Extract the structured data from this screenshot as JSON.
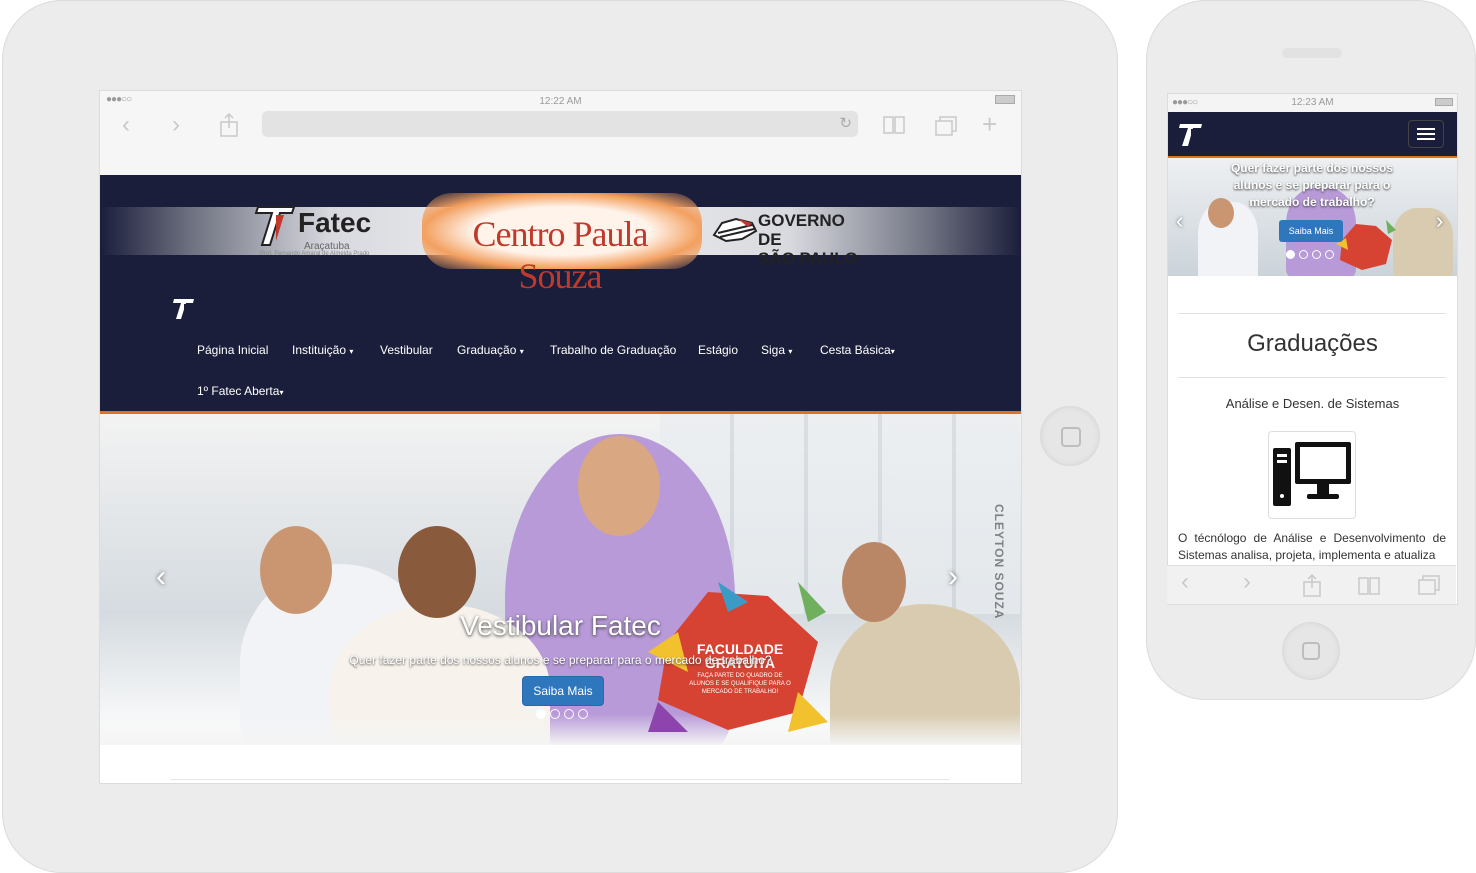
{
  "tablet": {
    "status": {
      "signal": "●●●○○",
      "time": "12:22 AM"
    },
    "header": {
      "fatec_word": "Fatec",
      "fatec_city": "Araçatuba",
      "fatec_patron": "Prof. Fernando Amaral de Almeida Prado",
      "center_logo": "Centro Paula Souza",
      "gov_logo_line1": "GOVERNO DE",
      "gov_logo_line2": "SÃO PAULO"
    },
    "nav": {
      "items": [
        {
          "label": "Página Inicial"
        },
        {
          "label": "Instituição"
        },
        {
          "label": "Vestibular"
        },
        {
          "label": "Graduação"
        },
        {
          "label": "Trabalho de Graduação"
        },
        {
          "label": "Estágio"
        },
        {
          "label": "Siga"
        },
        {
          "label": "Cesta Básica"
        },
        {
          "label": "1º Fatec Aberta"
        }
      ]
    },
    "hero": {
      "title": "Vestibular Fatec",
      "subtitle": "Quer fazer parte dos nossos alunos e se preparar para o mercado de trabalho?",
      "button": "Saiba Mais",
      "badge_title": "FACULDADE GRATUITA",
      "badge_text": "FAÇA PARTE DO QUADRO DE ALUNOS E SE QUALIFIQUE PARA O MERCADO DE TRABALHO!",
      "watermark": "CLEYTON SOUZA"
    }
  },
  "phone": {
    "status": {
      "signal": "●●●○○",
      "time": "12:23 AM"
    },
    "hero": {
      "text": "Quer fazer parte dos nossos alunos e se preparar para o mercado de trabalho?",
      "button": "Saiba Mais"
    },
    "section_title": "Graduações",
    "course_title": "Análise e Desen. de Sistemas",
    "course_desc": "O técnólogo de Análise e Desenvolvimento de Sistemas analisa, projeta, implementa e atualiza"
  },
  "colors": {
    "navy": "#1b1e3b",
    "orange_accent": "#e4701d",
    "button_blue": "#2f77bd",
    "logo_red": "#c0392b"
  },
  "icons": [
    "back-icon",
    "forward-icon",
    "share-icon",
    "bookmarks-icon",
    "tabs-icon",
    "add-tab-icon",
    "reload-icon",
    "menu-icon",
    "computer-icon"
  ]
}
